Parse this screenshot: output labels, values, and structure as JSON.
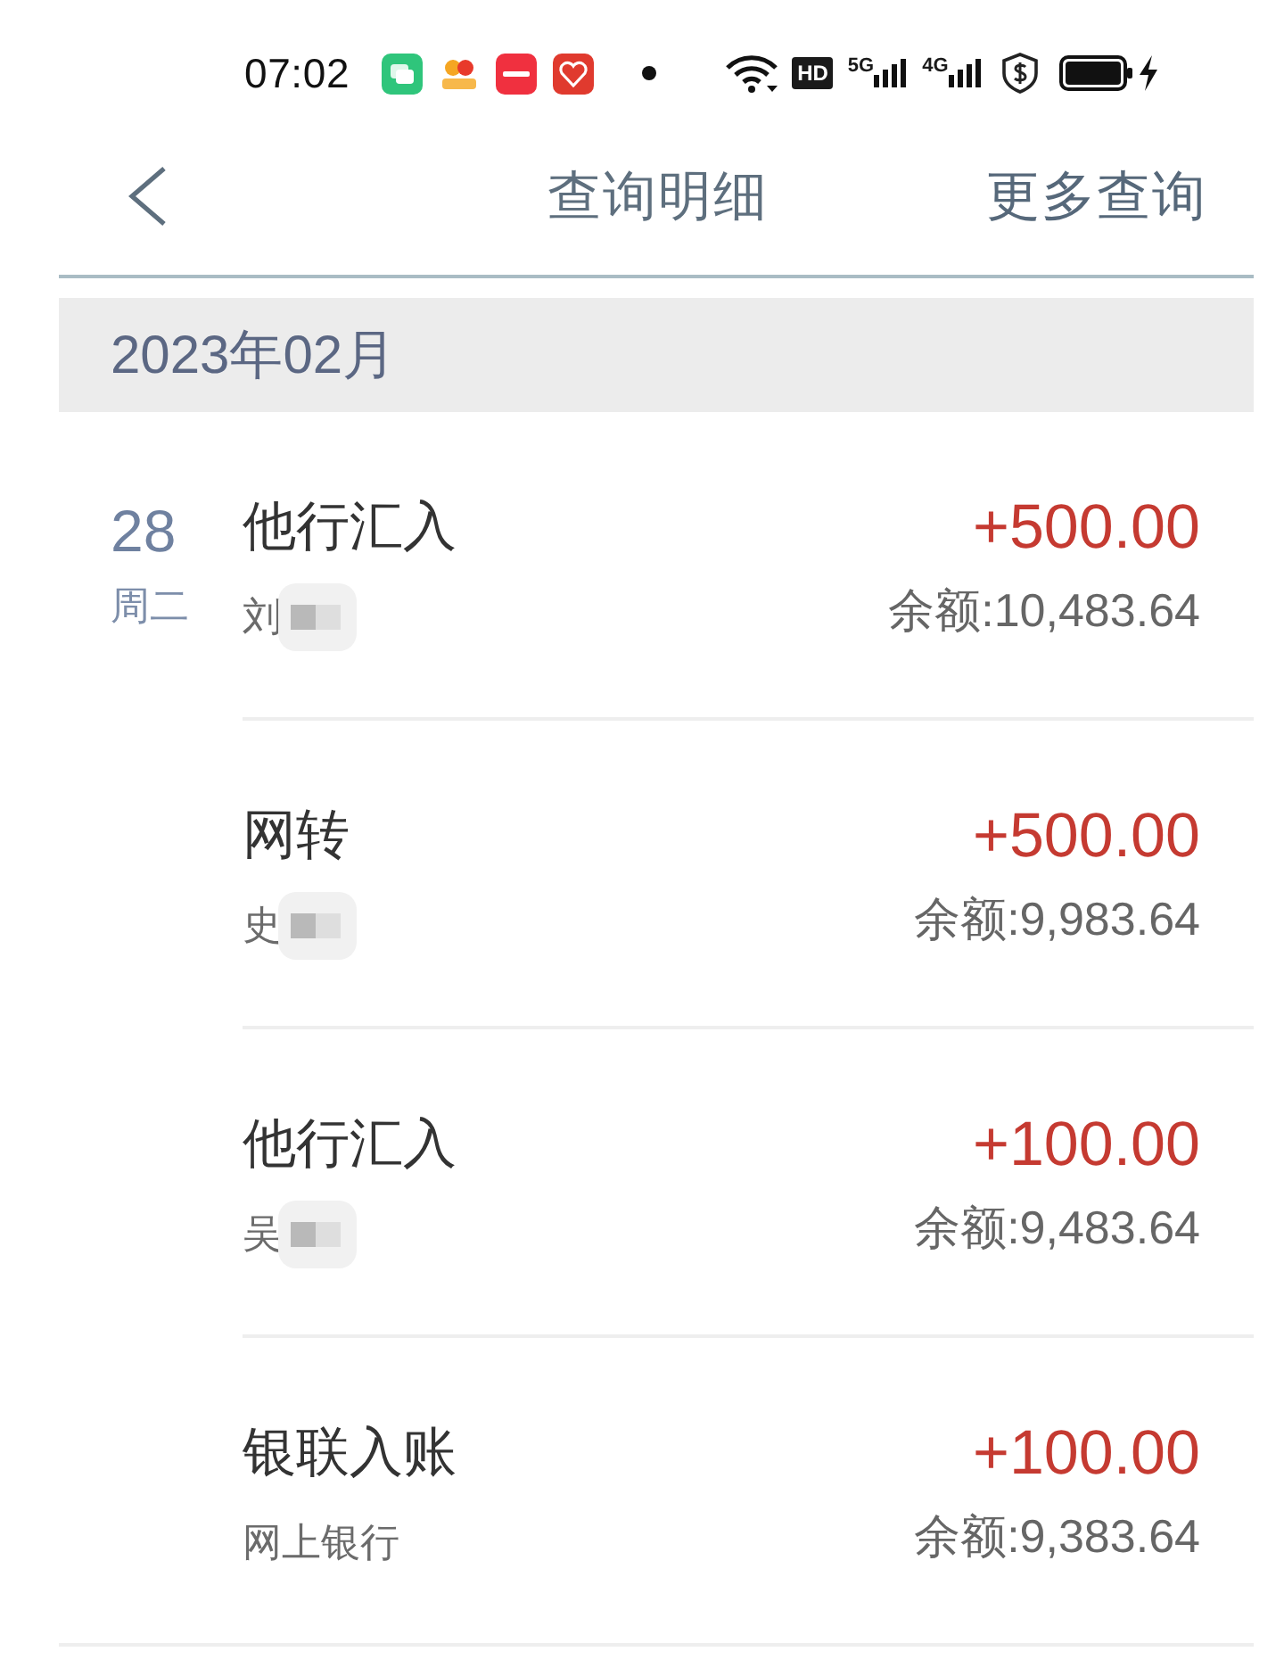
{
  "status_bar": {
    "time": "07:02",
    "hd_label": "HD",
    "network_labels": [
      "5G",
      "4G"
    ]
  },
  "nav": {
    "title": "查询明细",
    "action": "更多查询"
  },
  "month_header": "2023年02月",
  "transactions": [
    {
      "day": "28",
      "weekday": "周二",
      "title": "他行汇入",
      "counterparty": "刘",
      "redacted": true,
      "amount": "+500.00",
      "balance": "余额:10,483.64"
    },
    {
      "title": "网转",
      "counterparty": "史",
      "redacted": true,
      "amount": "+500.00",
      "balance": "余额:9,983.64"
    },
    {
      "title": "他行汇入",
      "counterparty": "吴",
      "redacted": true,
      "amount": "+100.00",
      "balance": "余额:9,483.64"
    },
    {
      "title": "银联入账",
      "counterparty": "网上银行",
      "redacted": false,
      "amount": "+100.00",
      "balance": "余额:9,383.64"
    }
  ]
}
